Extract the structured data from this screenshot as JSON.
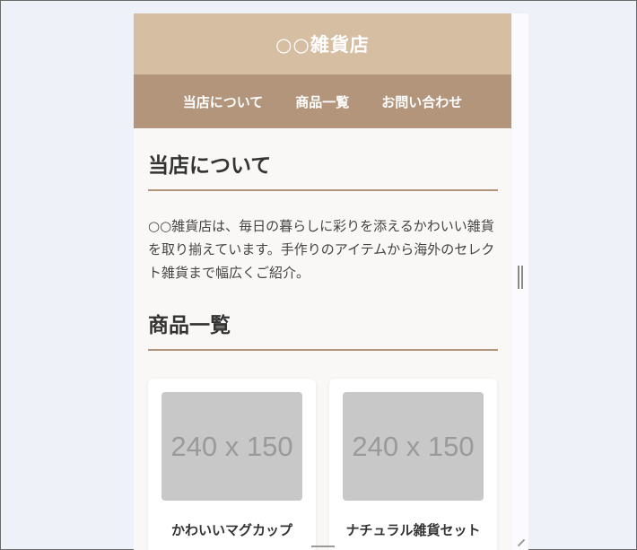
{
  "site": {
    "title": "○○雑貨店"
  },
  "nav": {
    "items": [
      {
        "label": "当店について"
      },
      {
        "label": "商品一覧"
      },
      {
        "label": "お問い合わせ"
      }
    ]
  },
  "about": {
    "heading": "当店について",
    "text": "○○雑貨店は、毎日の暮らしに彩りを添えるかわいい雑貨を取り揃えています。手作りのアイテムから海外のセレクト雑貨まで幅広くご紹介。"
  },
  "products": {
    "heading": "商品一覧",
    "items": [
      {
        "image_label": "240 x 150",
        "name": "かわいいマグカップ"
      },
      {
        "image_label": "240 x 150",
        "name": "ナチュラル雑貨セット"
      }
    ]
  },
  "colors": {
    "header_bg": "#d6bea3",
    "nav_bg": "#b3957c",
    "page_bg": "#faf8f6",
    "accent_line": "#b3957c"
  }
}
